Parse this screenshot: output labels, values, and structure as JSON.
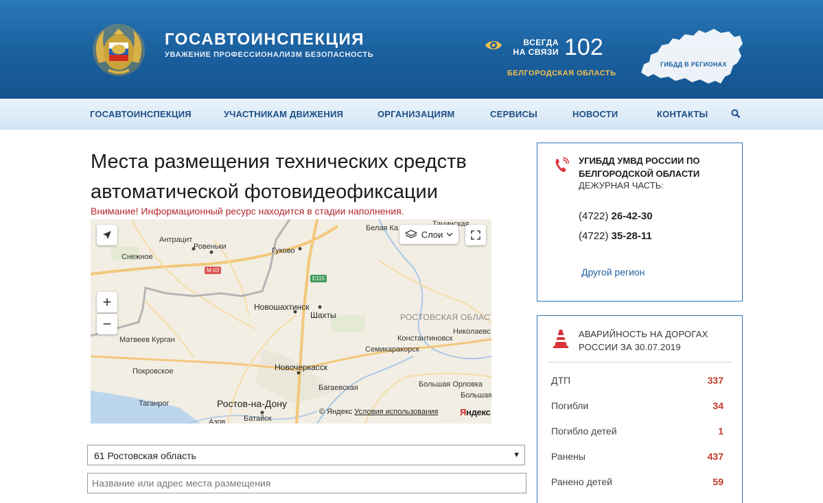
{
  "header": {
    "brand_title": "ГОСАВТОИНСПЕКЦИЯ",
    "brand_subtitle": "УВАЖЕНИЕ ПРОФЕССИОНАЛИЗМ БЕЗОПАСНОСТЬ",
    "always_line1": "ВСЕГДА",
    "always_line2": "НА СВЯЗИ",
    "hotline": "102",
    "region": "БЕЛГОРОДСКАЯ ОБЛАСТЬ",
    "regions_map_label": "ГИБДД В РЕГИОНАХ"
  },
  "nav": {
    "items": [
      {
        "label": "ГОСАВТОИНСПЕКЦИЯ"
      },
      {
        "label": "УЧАСТНИКАМ ДВИЖЕНИЯ"
      },
      {
        "label": "ОРГАНИЗАЦИЯМ"
      },
      {
        "label": "СЕРВИСЫ"
      },
      {
        "label": "НОВОСТИ"
      },
      {
        "label": "КОНТАКТЫ"
      }
    ]
  },
  "main": {
    "title": "Места размещения технических средств автоматической фотовидеофиксации",
    "warning": "Внимание! Информационный ресурс находится в стадии наполнения.",
    "map": {
      "layers_label": "Слои",
      "zoom_in": "+",
      "zoom_out": "−",
      "copyright": "© Яндекс",
      "terms_link": "Условия использования",
      "logo_first": "Я",
      "logo_rest": "ндекс",
      "places": {
        "antratsit": "Антрацит",
        "rovenki": "Ровеньки",
        "sukhodolsk": "Гуково",
        "snezhnoe": "Снежное",
        "belaya_kalitva": "Белая Ка",
        "tatsinskaya": "Тацинская",
        "novoshakhtinsk": "Новошахтинск",
        "shakhty": "Шахты",
        "region": "РОСТОВСКАЯ ОБЛАСТ",
        "nikolaevskaya": "Николаевс",
        "matveev_kurgan": "Матвеев Курган",
        "konstantinovsk": "Константиновск",
        "semikarakorsk": "Семикаракорск",
        "novocherkassk": "Новочеркасск",
        "pokrovskoe": "Покровское",
        "bolshaya_orlovka": "Большая Орловка",
        "bolshaya": "Большая",
        "bagaevskaya": "Багаевская",
        "taganrog": "Таганрог",
        "rostov": "Ростов-на-Дону",
        "bataysk": "Батайск",
        "azov": "Азов"
      },
      "roads": {
        "m03": "М-03",
        "e115": "Е115"
      }
    },
    "region_select_value": "61 Ростовская область",
    "search_placeholder": "Название или адрес места размещения"
  },
  "sidebar": {
    "contact": {
      "title": "УГИБДД УМВД РОССИИ ПО БЕЛГОРОДСКОЙ ОБЛАСТИ",
      "subtitle": "ДЕЖУРНАЯ ЧАСТЬ:",
      "phones": [
        {
          "code": "(4722)",
          "number": "26-42-30"
        },
        {
          "code": "(4722)",
          "number": "35-28-11"
        }
      ],
      "other_region": "Другой регион"
    },
    "accidents": {
      "title": "АВАРИЙНОСТЬ НА ДОРОГАХ РОССИИ ЗА 30.07.2019",
      "stats": [
        {
          "label": "ДТП",
          "value": "337"
        },
        {
          "label": "Погибли",
          "value": "34"
        },
        {
          "label": "Погибло детей",
          "value": "1"
        },
        {
          "label": "Ранены",
          "value": "437"
        },
        {
          "label": "Ранено детей",
          "value": "59"
        }
      ]
    }
  },
  "colors": {
    "header_blue": "#1a5f9e",
    "nav_text": "#1d4f83",
    "accent_gold": "#f2c04f",
    "warning_red": "#b3262c",
    "stat_red": "#c0392b"
  }
}
